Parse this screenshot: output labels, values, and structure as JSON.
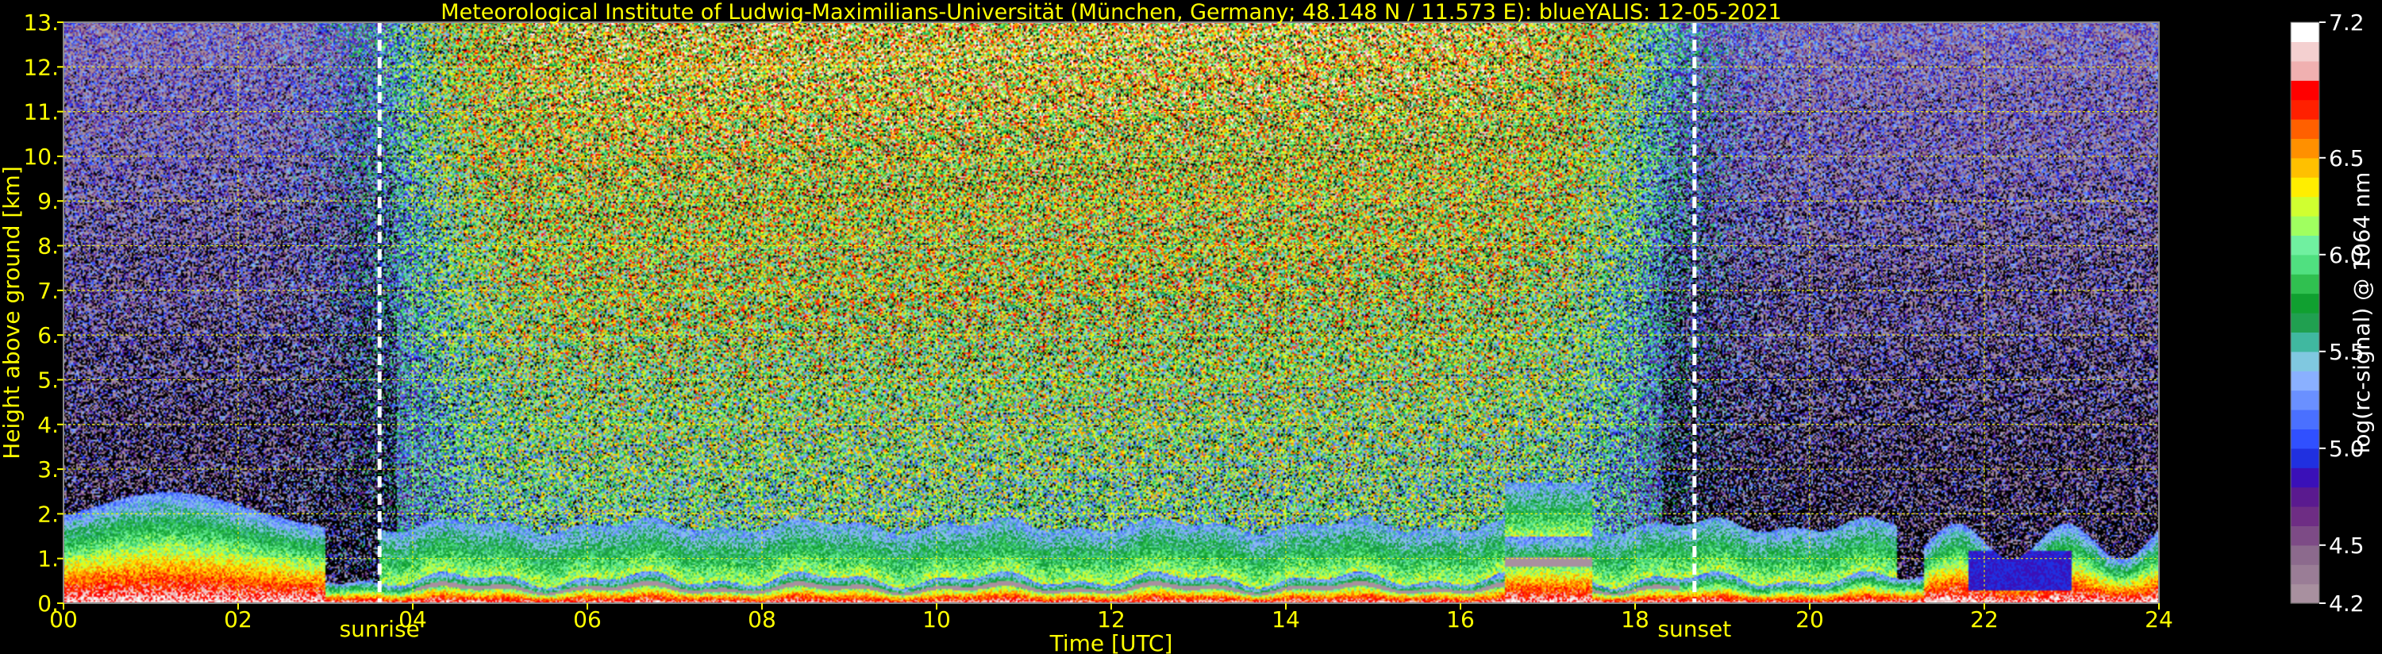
{
  "chart_data": {
    "type": "heatmap",
    "title": "Meteorological Institute of Ludwig-Maximilians-Universität (München, Germany; 48.148 N / 11.573 E):     blueYALIS: 12-05-2021",
    "xlabel": "Time [UTC]",
    "ylabel": "Height above ground [km]",
    "xlim": [
      0,
      24
    ],
    "ylim": [
      0,
      13
    ],
    "x_ticks": [
      "00",
      "02",
      "04",
      "06",
      "08",
      "10",
      "12",
      "14",
      "16",
      "18",
      "20",
      "22",
      "24"
    ],
    "x_tick_values": [
      0,
      2,
      4,
      6,
      8,
      10,
      12,
      14,
      16,
      18,
      20,
      22,
      24
    ],
    "y_ticks": [
      "0.",
      "1.",
      "2.",
      "3.",
      "4.",
      "5.",
      "6.",
      "7.",
      "8.",
      "9.",
      "10.",
      "11.",
      "12.",
      "13."
    ],
    "y_tick_values": [
      0,
      1,
      2,
      3,
      4,
      5,
      6,
      7,
      8,
      9,
      10,
      11,
      12,
      13
    ],
    "grid": true,
    "annotations": [
      {
        "label": "sunrise",
        "x": 3.62
      },
      {
        "label": "sunset",
        "x": 18.68
      }
    ],
    "colorbar": {
      "label": "log(rc-signal) @ 1064 nm",
      "ticks": [
        "4.2",
        "4.5",
        "5.0",
        "5.5",
        "6.0",
        "6.5",
        "7.2"
      ],
      "tick_values": [
        4.2,
        4.5,
        5.0,
        5.5,
        6.0,
        6.5,
        7.2
      ],
      "range": [
        4.2,
        7.2
      ],
      "colors": [
        "#a8909f",
        "#9a7d96",
        "#8c6a8d",
        "#7d4b86",
        "#6e2d84",
        "#5a1a8f",
        "#3a10b8",
        "#2030e0",
        "#3050ff",
        "#4a70ff",
        "#6a90ff",
        "#8ab0ff",
        "#80c8e0",
        "#40b8a0",
        "#20a050",
        "#10a030",
        "#30c050",
        "#50e080",
        "#70f0a0",
        "#a0ff60",
        "#d0ff30",
        "#ffee00",
        "#ffc000",
        "#ff9000",
        "#ff6000",
        "#ff2000",
        "#ff0000",
        "#f0b0b0",
        "#f4d0d0",
        "#ffffff"
      ]
    },
    "layers": [
      {
        "kind": "boundary_layer",
        "time_range": [
          0,
          24
        ],
        "height_range": [
          0,
          2.0
        ],
        "level": [
          5.0,
          7.2
        ]
      },
      {
        "kind": "noise_background",
        "time_range": [
          0,
          24
        ],
        "height_range": [
          0,
          13
        ],
        "level": [
          4.5,
          6.8
        ]
      }
    ]
  }
}
